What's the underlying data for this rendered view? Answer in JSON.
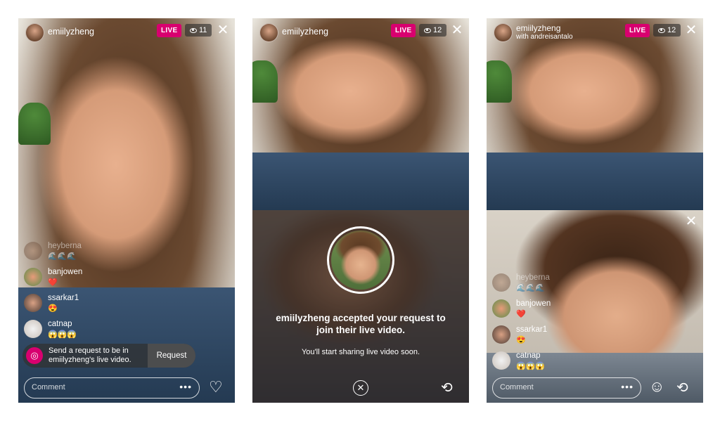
{
  "panel1": {
    "username": "emiilyzheng",
    "live_label": "LIVE",
    "viewers": "11",
    "comments": [
      {
        "name": "heyberna",
        "emoji": "🌊🌊🌊"
      },
      {
        "name": "banjowen",
        "emoji": "❤️"
      },
      {
        "name": "ssarkar1",
        "emoji": "😍"
      },
      {
        "name": "catnap",
        "emoji": "😱😱😱"
      }
    ],
    "request_text": "Send a request to be in emiilyzheng's live video.",
    "request_button": "Request",
    "comment_placeholder": "Comment"
  },
  "panel2": {
    "username": "emiilyzheng",
    "live_label": "LIVE",
    "viewers": "12",
    "accepted_title": "emiilyzheng accepted your request to join their live video.",
    "accepted_sub": "You'll start sharing live video soon."
  },
  "panel3": {
    "username": "emiilyzheng",
    "with_line": "with andreisantalo",
    "live_label": "LIVE",
    "viewers": "12",
    "comments": [
      {
        "name": "heyberna",
        "emoji": "🌊🌊🌊"
      },
      {
        "name": "banjowen",
        "emoji": "❤️"
      },
      {
        "name": "ssarkar1",
        "emoji": "😍"
      },
      {
        "name": "catnap",
        "emoji": "😱😱😱"
      }
    ],
    "comment_placeholder": "Comment"
  },
  "icons": {
    "close": "close-icon",
    "eye": "eye-icon",
    "heart": "heart-icon",
    "flip": "camera-flip-icon",
    "face_effects": "face-effects-icon"
  }
}
